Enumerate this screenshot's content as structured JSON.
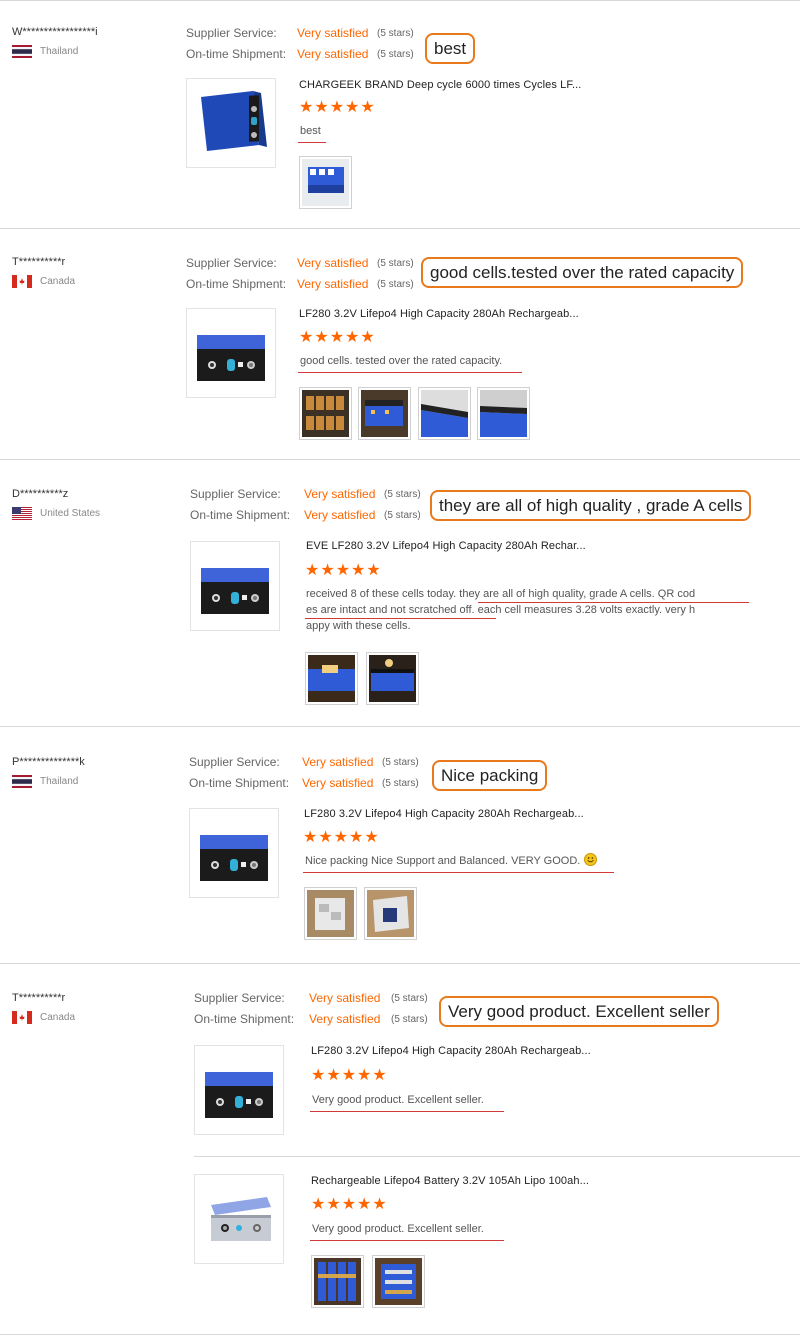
{
  "labels": {
    "supplier_service": "Supplier Service:",
    "ontime_shipment": "On-time Shipment:"
  },
  "reviews": [
    {
      "user": "W*****************i",
      "country": "Thailand",
      "flag": "thailand-flag-icon",
      "supplier_value": "Very satisfied",
      "supplier_stars": "(5 stars)",
      "shipment_value": "Very satisfied",
      "shipment_stars": "(5 stars)",
      "callout": "best",
      "products": [
        {
          "title": "CHARGEEK BRAND Deep cycle 6000 times Cycles LF...",
          "rating": "★★★★★",
          "comment": "best",
          "images": 1
        }
      ]
    },
    {
      "user": "T**********r",
      "country": "Canada",
      "flag": "canada-flag-icon",
      "supplier_value": "Very satisfied",
      "supplier_stars": "(5 stars)",
      "shipment_value": "Very satisfied",
      "shipment_stars": "(5 stars)",
      "callout": "good cells.tested over the rated capacity",
      "products": [
        {
          "title": "LF280 3.2V Lifepo4 High Capacity 280Ah Rechargeab...",
          "rating": "★★★★★",
          "comment": "good cells. tested over the rated capacity.",
          "images": 4
        }
      ]
    },
    {
      "user": "D**********z",
      "country": "United States",
      "flag": "usa-flag-icon",
      "supplier_value": "Very satisfied",
      "supplier_stars": "(5 stars)",
      "shipment_value": "Very satisfied",
      "shipment_stars": "(5 stars)",
      "callout": "they are all of high quality , grade A cells",
      "products": [
        {
          "title": "EVE LF280 3.2V Lifepo4 High Capacity 280Ah Rechar...",
          "rating": "★★★★★",
          "comment_line1": "received 8 of these cells today.  they are all of high quality,  grade A cells.   QR cod",
          "comment_line2": "es are intact and not scratched off.   each cell measures 3.28 volts exactly.  very h",
          "comment_line3": "appy with these cells.",
          "images": 2
        }
      ]
    },
    {
      "user": "P**************k",
      "country": "Thailand",
      "flag": "thailand-flag-icon",
      "supplier_value": "Very satisfied",
      "supplier_stars": "(5 stars)",
      "shipment_value": "Very satisfied",
      "shipment_stars": "(5 stars)",
      "callout": "Nice packing",
      "products": [
        {
          "title": "LF280 3.2V Lifepo4 High Capacity 280Ah Rechargeab...",
          "rating": "★★★★★",
          "comment": "Nice packing Nice Support and Balanced. VERY GOOD.",
          "images": 2
        }
      ]
    },
    {
      "user": "T**********r",
      "country": "Canada",
      "flag": "canada-flag-icon",
      "supplier_value": "Very satisfied",
      "supplier_stars": "(5 stars)",
      "shipment_value": "Very satisfied",
      "shipment_stars": "(5 stars)",
      "callout": "Very good product. Excellent seller",
      "products": [
        {
          "title": "LF280 3.2V Lifepo4 High Capacity 280Ah Rechargeab...",
          "rating": "★★★★★",
          "comment": "Very good product. Excellent seller.",
          "images": 0
        },
        {
          "title": "Rechargeable Lifepo4 Battery 3.2V 105Ah Lipo 100ah...",
          "rating": "★★★★★",
          "comment": "Very good product. Excellent seller.",
          "images": 2
        }
      ]
    }
  ],
  "colors": {
    "accent": "#ff6600",
    "callout_border": "#e8791c",
    "underline": "#d23a3a",
    "battery_blue": "#2f5bd6"
  }
}
